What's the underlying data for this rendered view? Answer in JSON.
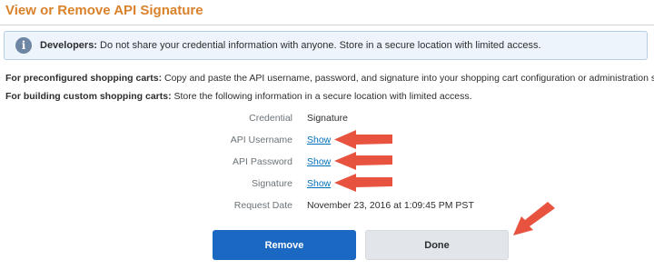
{
  "page": {
    "title": "View or Remove API Signature"
  },
  "notice": {
    "icon": "info-icon",
    "label": "Developers:",
    "text": " Do not share your credential information with anyone. Store in a secure location with limited access."
  },
  "paragraphs": [
    {
      "label": "For preconfigured shopping carts:",
      "text": " Copy and paste the API username, password, and signature into your shopping cart configuration or administration screen."
    },
    {
      "label": "For building custom shopping carts:",
      "text": " Store the following information in a secure location with limited access."
    }
  ],
  "credentials": [
    {
      "label": "Credential",
      "value": "Signature"
    },
    {
      "label": "API Username",
      "value": "Show"
    },
    {
      "label": "API Password",
      "value": "Show"
    },
    {
      "label": "Signature",
      "value": "Show"
    },
    {
      "label": "Request Date",
      "value": "November 23, 2016 at 1:09:45 PM PST"
    }
  ],
  "buttons": {
    "remove": "Remove",
    "done": "Done"
  },
  "annotations": {
    "arrow_color": "#e8533f",
    "arrow_count": 4
  }
}
